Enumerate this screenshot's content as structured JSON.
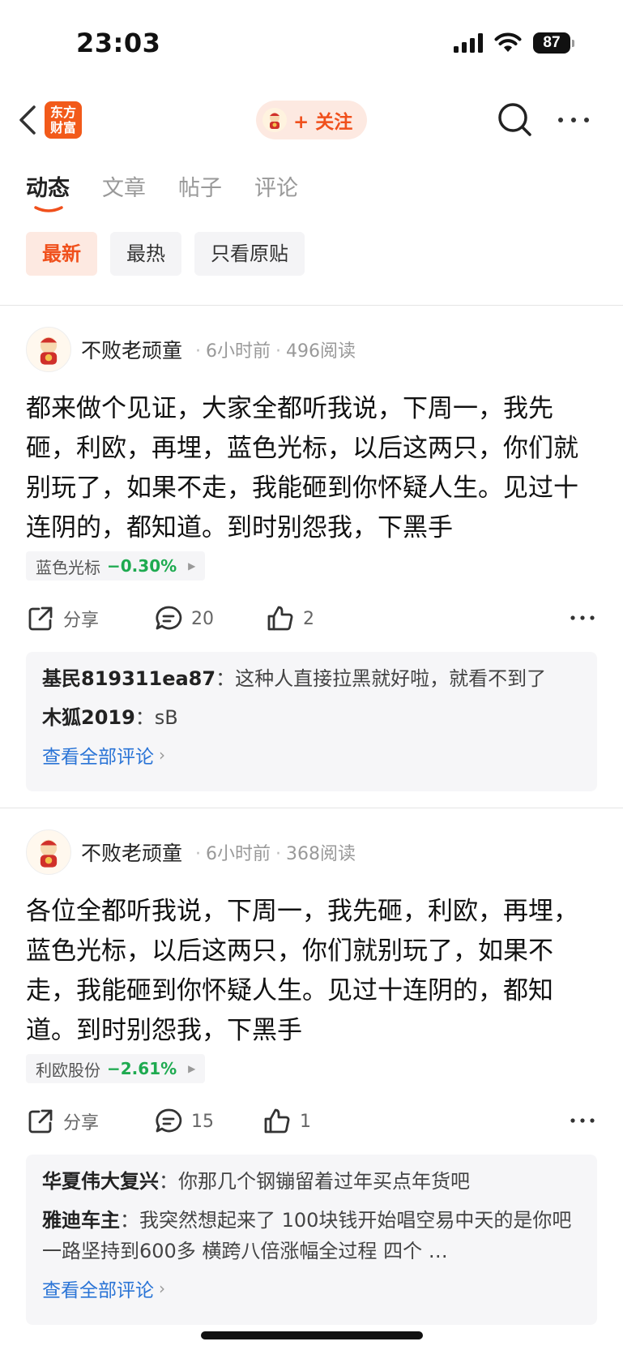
{
  "status_bar": {
    "time": "23:03",
    "battery": "87"
  },
  "nav": {
    "logo_text": "东方\n财富",
    "follow_label": "+ 关注"
  },
  "tabs": [
    {
      "label": "动态"
    },
    {
      "label": "文章"
    },
    {
      "label": "帖子"
    },
    {
      "label": "评论"
    }
  ],
  "filters": [
    {
      "label": "最新"
    },
    {
      "label": "最热"
    },
    {
      "label": "只看原贴"
    }
  ],
  "posts": [
    {
      "author": "不败老顽童",
      "time": "6小时前",
      "reads": "496阅读",
      "body": "都来做个见证，大家全都听我说，下周一，我先砸，利欧，再埋，蓝色光标，以后这两只，你们就别玩了，如果不走，我能砸到你怀疑人生。见过十连阴的，都知道。到时别怨我，下黑手",
      "stock": {
        "name": "蓝色光标",
        "change": "−0.30%"
      },
      "share_label": "分享",
      "comment_count": "20",
      "like_count": "2",
      "comments": [
        {
          "user": "基民819311ea87",
          "text": "这种人直接拉黑就好啦，就看不到了"
        },
        {
          "user": "木狐2019",
          "text": "sB"
        }
      ],
      "view_all": "查看全部评论"
    },
    {
      "author": "不败老顽童",
      "time": "6小时前",
      "reads": "368阅读",
      "body": "各位全都听我说，下周一，我先砸，利欧，再埋，蓝色光标，以后这两只，你们就别玩了，如果不走，我能砸到你怀疑人生。见过十连阴的，都知道。到时别怨我，下黑手",
      "stock": {
        "name": "利欧股份",
        "change": "−2.61%"
      },
      "share_label": "分享",
      "comment_count": "15",
      "like_count": "1",
      "comments": [
        {
          "user": "华夏伟大复兴",
          "text": "你那几个钢镚留着过年买点年货吧"
        },
        {
          "user": "雅迪车主",
          "text": "我突然想起来了 100块钱开始唱空易中天的是你吧 一路坚持到600多 横跨八倍涨幅全过程 四个 …"
        }
      ],
      "view_all": "查看全部评论"
    }
  ],
  "colors": {
    "accent": "#f0501c",
    "down": "#1eaa50",
    "link": "#2a74d6"
  }
}
